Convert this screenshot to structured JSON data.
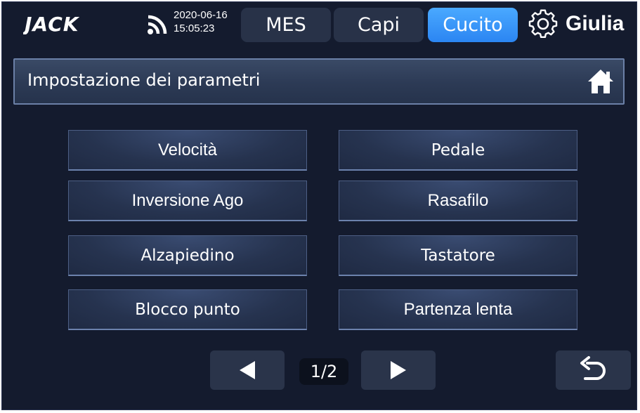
{
  "header": {
    "logo_text": "JACK",
    "date": "2020-06-16",
    "time": "15:05:23",
    "tabs": [
      {
        "label": "MES",
        "active": false
      },
      {
        "label": "Capi",
        "active": false
      },
      {
        "label": "Cucito",
        "active": true
      }
    ],
    "settings_icon": "gear-icon",
    "user": "Giulia"
  },
  "titlebar": {
    "title": "Impostazione dei parametri",
    "home_icon": "home-icon"
  },
  "parameters": {
    "items": [
      {
        "label": "Velocità"
      },
      {
        "label": "Pedale"
      },
      {
        "label": "Inversione Ago"
      },
      {
        "label": "Rasafilo"
      },
      {
        "label": "Alzapiedino"
      },
      {
        "label": "Tastatore"
      },
      {
        "label": "Blocco punto"
      },
      {
        "label": "Partenza lenta"
      }
    ]
  },
  "pagination": {
    "indicator": "1/2",
    "prev_icon": "triangle-left-icon",
    "next_icon": "triangle-right-icon",
    "back_icon": "undo-arrow-icon"
  },
  "colors": {
    "background": "#141b2e",
    "tab": "#283248",
    "tab_active": "#2b85f2",
    "text": "#ffffff"
  }
}
